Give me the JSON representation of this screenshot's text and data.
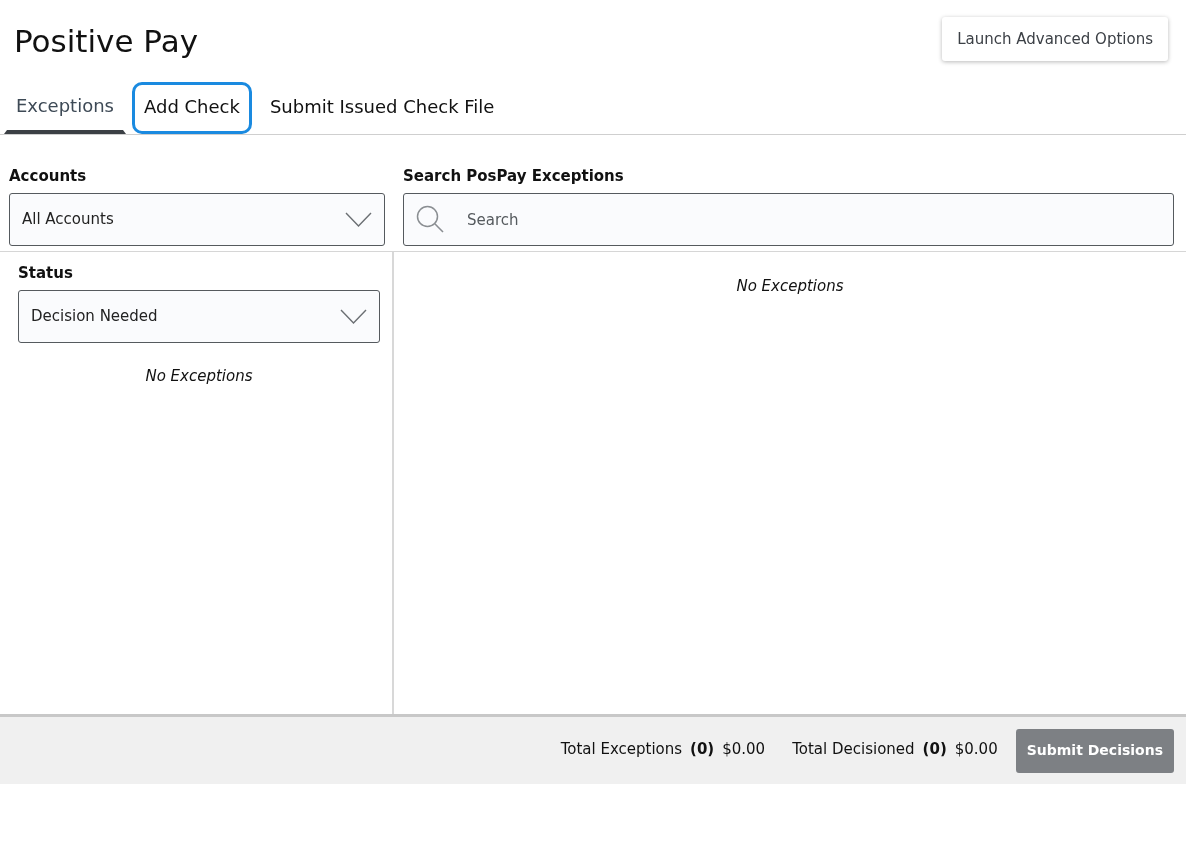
{
  "page": {
    "title": "Positive Pay",
    "header_button": {
      "label": "Launch Advanced Options"
    }
  },
  "tabs": [
    {
      "label": "Exceptions",
      "selected": true,
      "focused": false
    },
    {
      "label": "Add Check",
      "selected": false,
      "focused": true
    },
    {
      "label": "Submit Issued Check File",
      "selected": false,
      "focused": false
    }
  ],
  "filters": {
    "accounts": {
      "label": "Accounts",
      "value": "All Accounts"
    },
    "search": {
      "label": "Search PosPay Exceptions",
      "placeholder": "Search"
    }
  },
  "status_panel": {
    "label": "Status",
    "value": "Decision Needed",
    "empty_message": "No Exceptions"
  },
  "detail_panel": {
    "empty_message": "No Exceptions"
  },
  "footer": {
    "totals": [
      {
        "label": "Total Exceptions",
        "count": "(0)",
        "amount": "$0.00"
      },
      {
        "label": "Total Decisioned",
        "count": "(0)",
        "amount": "$0.00"
      }
    ],
    "submit_button": {
      "label": "Submit Decisions",
      "disabled": true
    }
  }
}
